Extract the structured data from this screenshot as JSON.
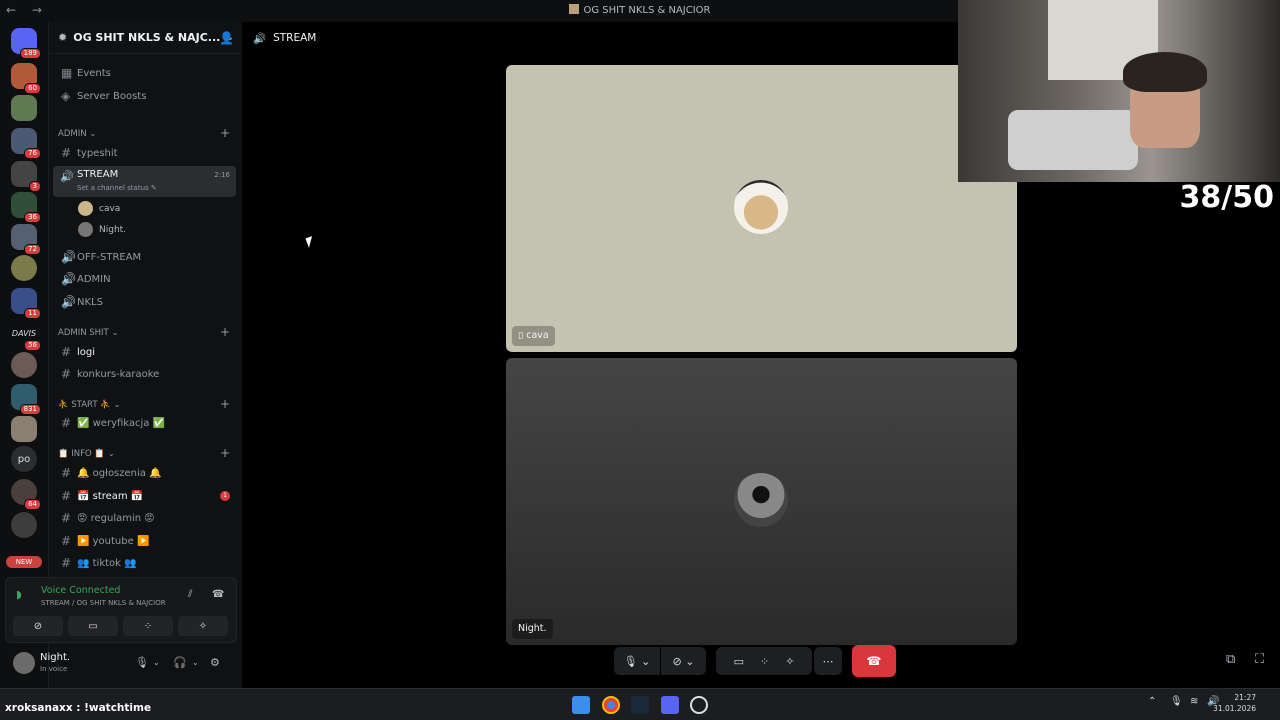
{
  "window": {
    "title": "OG SHIT NKLS & NAJCIOR",
    "nav": "← →"
  },
  "servers": [
    {
      "badge": "189"
    },
    {
      "badge": "60"
    },
    {
      "badge": ""
    },
    {
      "badge": "76"
    },
    {
      "badge": "3"
    },
    {
      "badge": "36"
    },
    {
      "badge": "72"
    },
    {
      "badge": ""
    },
    {
      "badge": "11"
    },
    {
      "label": "DAVIS",
      "badge": "56"
    },
    {
      "badge": ""
    },
    {
      "badge": "831"
    },
    {
      "badge": ""
    },
    {
      "label": "po",
      "badge": ""
    },
    {
      "badge": "64"
    },
    {
      "badge": ""
    }
  ],
  "new_pill": "NEW",
  "server_header": {
    "name": "OG SHIT NKLS & NAJC...",
    "chev": "⌄",
    "invite_icon": "add-member-icon"
  },
  "top_items": [
    {
      "label": "Events",
      "icon": "calendar-icon"
    },
    {
      "label": "Server Boosts",
      "icon": "boost-icon"
    }
  ],
  "categories": {
    "admin": "ADMIN ⌄",
    "admin_shit": "ADMIN SHIT ⌄",
    "start": "⛹ START ⛹ ⌄",
    "info": "📋 INFO 📋 ⌄"
  },
  "channels": {
    "typeshit": "typeshit",
    "stream": {
      "name": "STREAM",
      "status": "Set a channel status ✎",
      "timer": "2:16"
    },
    "voice_users": [
      "cava",
      "Night."
    ],
    "off_stream": "OFF-STREAM",
    "admin": "ADMIN",
    "nkls": "NKLS",
    "logi": "logi",
    "karaoke": "konkurs-karaoke",
    "weryfikacja": "✅ weryfikacja ✅",
    "ogloszenia": "🔔 ogłoszenia 🔔",
    "stream_text": "📅 stream 📅",
    "stream_unread": "1",
    "regulamin": "😡 regulamin 😡",
    "youtube": "▶️ youtube ▶️",
    "tiktok": "👥 tiktok 👥"
  },
  "voice_panel": {
    "status": "Voice Connected",
    "location": "STREAM / OG SHIT NKLS & NAJCIOR"
  },
  "user": {
    "name": "Night.",
    "status": "In voice"
  },
  "main_header": {
    "channel": "STREAM"
  },
  "tiles": [
    {
      "name": "cava",
      "has_phone_icon": true
    },
    {
      "name": "Night."
    }
  ],
  "counter": "38/50",
  "chat_overlay": "xroksanaxx : !watchtime",
  "clock": {
    "time": "21:27",
    "date": "31.01.2026"
  },
  "colors": {
    "accent_green": "#3ba55c",
    "danger": "#da373c",
    "badge": "#d83c3e"
  }
}
